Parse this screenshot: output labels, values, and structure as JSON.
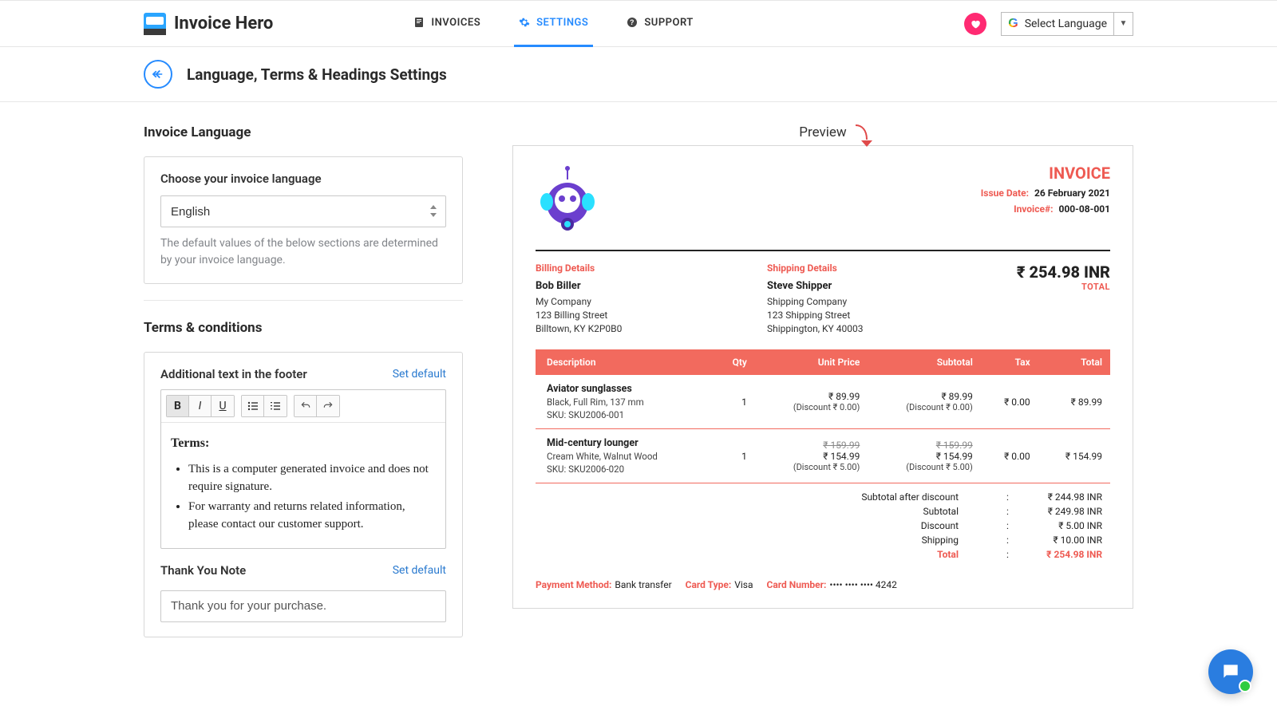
{
  "app": {
    "name": "Invoice Hero"
  },
  "nav": {
    "invoices": "INVOICES",
    "settings": "SETTINGS",
    "support": "SUPPORT",
    "language_selector": "Select Language"
  },
  "page": {
    "title": "Language, Terms & Headings Settings"
  },
  "lang_section": {
    "heading": "Invoice Language",
    "label": "Choose your invoice language",
    "value": "English",
    "help": "The default values of the below sections are determined by your invoice language."
  },
  "terms_section": {
    "heading": "Terms & conditions",
    "footer_label": "Additional text in the footer",
    "set_default": "Set default",
    "terms_heading": "Terms:",
    "terms_items": [
      "This is a computer generated invoice and does not require signature.",
      "For warranty and returns related information, please contact our customer support."
    ],
    "thank_you_label": "Thank You Note",
    "thank_you_value": "Thank you for your purchase."
  },
  "preview": {
    "label": "Preview",
    "invoice_title": "INVOICE",
    "issue_date_label": "Issue Date:",
    "issue_date": "26 February 2021",
    "invoice_no_label": "Invoice#:",
    "invoice_no": "000-08-001",
    "billing": {
      "heading": "Billing Details",
      "name": "Bob Biller",
      "company": "My Company",
      "street": "123 Billing Street",
      "city": "Billtown, KY K2P0B0"
    },
    "shipping": {
      "heading": "Shipping Details",
      "name": "Steve Shipper",
      "company": "Shipping Company",
      "street": "123 Shipping Street",
      "city": "Shippington, KY 40003"
    },
    "grand_total": "₹ 254.98 INR",
    "grand_total_label": "TOTAL",
    "columns": {
      "desc": "Description",
      "qty": "Qty",
      "unit": "Unit Price",
      "subtotal": "Subtotal",
      "tax": "Tax",
      "total": "Total"
    },
    "items": [
      {
        "name": "Aviator sunglasses",
        "sub": "Black, Full Rim, 137 mm",
        "sku": "SKU: SKU2006-001",
        "qty": "1",
        "unit": "₹ 89.99",
        "unit_strike": "",
        "unit_disc": "(Discount ₹ 0.00)",
        "subtotal": "₹ 89.99",
        "subtotal_strike": "",
        "subtotal_disc": "(Discount ₹ 0.00)",
        "tax": "₹ 0.00",
        "total": "₹ 89.99"
      },
      {
        "name": "Mid-century lounger",
        "sub": "Cream White, Walnut Wood",
        "sku": "SKU: SKU2006-020",
        "qty": "1",
        "unit": "₹ 154.99",
        "unit_strike": "₹ 159.99",
        "unit_disc": "(Discount ₹ 5.00)",
        "subtotal": "₹ 154.99",
        "subtotal_strike": "₹ 159.99",
        "subtotal_disc": "(Discount ₹ 5.00)",
        "tax": "₹ 0.00",
        "total": "₹ 154.99"
      }
    ],
    "summary": {
      "after_disc_k": "Subtotal after discount",
      "after_disc_v": "₹ 244.98 INR",
      "subtotal_k": "Subtotal",
      "subtotal_v": "₹ 249.98 INR",
      "discount_k": "Discount",
      "discount_v": "₹ 5.00 INR",
      "shipping_k": "Shipping",
      "shipping_v": "₹ 10.00 INR",
      "total_k": "Total",
      "total_v": "₹ 254.98 INR"
    },
    "payment": {
      "method_k": "Payment Method:",
      "method_v": "Bank transfer",
      "card_type_k": "Card Type:",
      "card_type_v": "Visa",
      "card_num_k": "Card Number:",
      "card_num_v": "•••• •••• •••• 4242"
    }
  }
}
